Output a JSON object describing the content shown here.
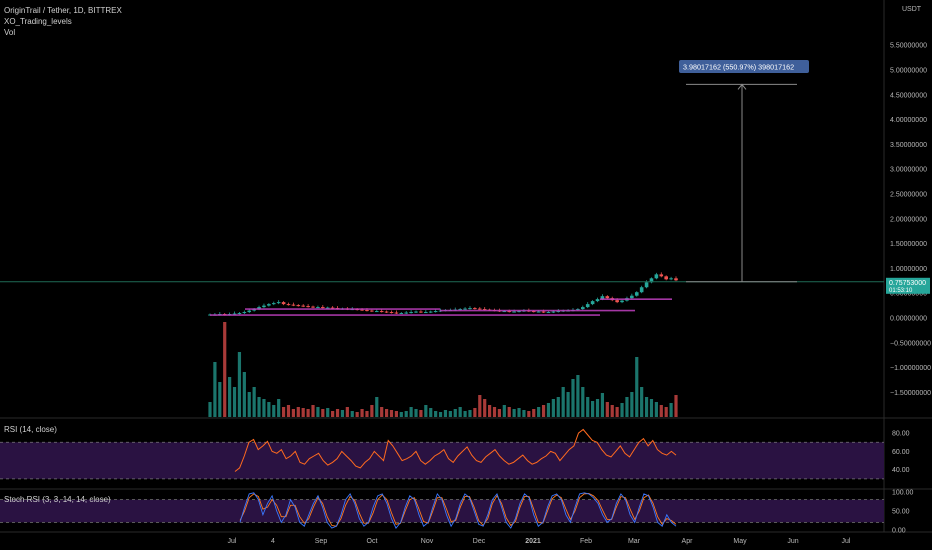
{
  "header": {
    "symbol_line": "OriginTrail / Tether, 1D, BITTREX",
    "indicator_1": "XO_Trading_levels",
    "indicator_2": "Vol"
  },
  "chart_data": {
    "type": "candlestick",
    "currency_label": "USDT",
    "price_axis_ticks": [
      "5.50000000",
      "5.00000000",
      "4.50000000",
      "4.00000000",
      "3.50000000",
      "3.00000000",
      "2.50000000",
      "2.00000000",
      "1.50000000",
      "1.00000000",
      "0.50000000",
      "0.00000000",
      "−0.50000000",
      "−1.00000000",
      "−1.50000000"
    ],
    "price_axis_values": [
      5.5,
      5.0,
      4.5,
      4.0,
      3.5,
      3.0,
      2.5,
      2.0,
      1.5,
      1.0,
      0.5,
      0.0,
      -0.5,
      -1.0,
      -1.5
    ],
    "x_tick_labels": [
      "Jul",
      "4",
      "Sep",
      "Oct",
      "Nov",
      "Dec",
      "2021",
      "Feb",
      "Mar",
      "Apr",
      "May",
      "Jun",
      "Jul"
    ],
    "current_price": "0.75753000",
    "countdown": "01:53:10",
    "measure_label": "3.98017162 (550.97%) 398017162",
    "measure_from": 0.73,
    "measure_to": 4.71,
    "price_path": [
      0.07,
      0.07,
      0.08,
      0.07,
      0.08,
      0.09,
      0.1,
      0.12,
      0.15,
      0.18,
      0.22,
      0.25,
      0.28,
      0.3,
      0.32,
      0.28,
      0.27,
      0.26,
      0.25,
      0.24,
      0.23,
      0.22,
      0.22,
      0.21,
      0.21,
      0.2,
      0.19,
      0.19,
      0.18,
      0.18,
      0.17,
      0.16,
      0.15,
      0.14,
      0.14,
      0.13,
      0.12,
      0.11,
      0.1,
      0.1,
      0.11,
      0.12,
      0.13,
      0.12,
      0.12,
      0.13,
      0.14,
      0.15,
      0.16,
      0.16,
      0.17,
      0.18,
      0.19,
      0.2,
      0.19,
      0.18,
      0.17,
      0.16,
      0.15,
      0.14,
      0.14,
      0.13,
      0.13,
      0.14,
      0.15,
      0.14,
      0.13,
      0.13,
      0.12,
      0.12,
      0.13,
      0.14,
      0.15,
      0.15,
      0.16,
      0.18,
      0.22,
      0.28,
      0.34,
      0.38,
      0.44,
      0.4,
      0.36,
      0.32,
      0.35,
      0.4,
      0.45,
      0.52,
      0.62,
      0.72,
      0.8,
      0.88,
      0.84,
      0.78,
      0.8,
      0.76
    ],
    "levels": [
      {
        "value": 0.06,
        "color": "#c040c0"
      },
      {
        "value": 0.2,
        "color": "#c040c0"
      },
      {
        "value": 0.15,
        "color": "#c040c0"
      },
      {
        "value": 0.35,
        "color": "#c040c0"
      }
    ],
    "volume": [
      0.15,
      0.55,
      0.35,
      0.95,
      0.4,
      0.3,
      0.65,
      0.45,
      0.25,
      0.3,
      0.2,
      0.18,
      0.15,
      0.12,
      0.18,
      0.1,
      0.12,
      0.08,
      0.1,
      0.09,
      0.08,
      0.12,
      0.1,
      0.08,
      0.09,
      0.06,
      0.08,
      0.07,
      0.1,
      0.06,
      0.05,
      0.08,
      0.06,
      0.12,
      0.2,
      0.1,
      0.08,
      0.07,
      0.06,
      0.05,
      0.06,
      0.1,
      0.08,
      0.07,
      0.12,
      0.09,
      0.06,
      0.05,
      0.07,
      0.06,
      0.08,
      0.1,
      0.06,
      0.07,
      0.09,
      0.22,
      0.18,
      0.12,
      0.1,
      0.08,
      0.12,
      0.1,
      0.08,
      0.09,
      0.07,
      0.06,
      0.08,
      0.1,
      0.12,
      0.14,
      0.18,
      0.2,
      0.3,
      0.25,
      0.38,
      0.42,
      0.3,
      0.2,
      0.16,
      0.18,
      0.24,
      0.15,
      0.12,
      0.1,
      0.14,
      0.2,
      0.25,
      0.6,
      0.3,
      0.2,
      0.18,
      0.15,
      0.12,
      0.1,
      0.14,
      0.22
    ],
    "rsi": {
      "label": "RSI (14, close)",
      "ticks": [
        "80.00",
        "60.00",
        "40.00"
      ],
      "tick_values": [
        80,
        60,
        40
      ],
      "band": [
        30,
        70
      ],
      "values": [
        38,
        42,
        55,
        70,
        73,
        62,
        66,
        71,
        60,
        58,
        62,
        52,
        55,
        60,
        48,
        46,
        52,
        55,
        58,
        50,
        45,
        48,
        52,
        60,
        55,
        50,
        44,
        42,
        48,
        52,
        60,
        55,
        50,
        72,
        66,
        58,
        50,
        52,
        55,
        60,
        50,
        46,
        50,
        55,
        58,
        62,
        52,
        48,
        55,
        60,
        65,
        56,
        50,
        48,
        54,
        58,
        62,
        55,
        50,
        46,
        48,
        52,
        56,
        50,
        46,
        48,
        52,
        55,
        60,
        58,
        50,
        56,
        62,
        66,
        80,
        84,
        78,
        72,
        70,
        62,
        56,
        54,
        60,
        66,
        58,
        54,
        62,
        70,
        74,
        66,
        72,
        62,
        58,
        56,
        60,
        56
      ]
    },
    "stoch_rsi": {
      "label": "Stoch RSI (3, 3, 14, 14, close)",
      "ticks": [
        "100.00",
        "50.00",
        "0.00"
      ],
      "tick_values": [
        100,
        50,
        0
      ],
      "band": [
        20,
        80
      ],
      "k": [
        20,
        60,
        95,
        98,
        80,
        40,
        70,
        90,
        50,
        20,
        40,
        80,
        60,
        20,
        10,
        40,
        70,
        90,
        60,
        20,
        5,
        10,
        40,
        80,
        95,
        70,
        30,
        10,
        20,
        60,
        90,
        95,
        70,
        30,
        5,
        20,
        60,
        90,
        80,
        40,
        10,
        20,
        60,
        95,
        80,
        40,
        10,
        30,
        70,
        95,
        85,
        50,
        15,
        10,
        40,
        80,
        95,
        60,
        20,
        5,
        30,
        70,
        95,
        85,
        40,
        10,
        20,
        60,
        90,
        95,
        80,
        40,
        20,
        60,
        95,
        98,
        95,
        85,
        70,
        40,
        20,
        30,
        70,
        95,
        80,
        40,
        20,
        60,
        95,
        90,
        60,
        20,
        10,
        40,
        20,
        10
      ],
      "d": [
        25,
        50,
        85,
        95,
        88,
        55,
        60,
        80,
        65,
        35,
        35,
        65,
        65,
        35,
        18,
        30,
        60,
        85,
        70,
        35,
        12,
        10,
        30,
        65,
        88,
        78,
        45,
        18,
        18,
        45,
        80,
        92,
        80,
        45,
        15,
        18,
        50,
        80,
        85,
        55,
        22,
        18,
        50,
        85,
        85,
        55,
        22,
        25,
        60,
        88,
        88,
        60,
        25,
        12,
        30,
        70,
        90,
        70,
        32,
        12,
        22,
        60,
        88,
        88,
        55,
        20,
        18,
        50,
        82,
        92,
        85,
        55,
        28,
        50,
        85,
        95,
        96,
        90,
        78,
        52,
        28,
        28,
        60,
        88,
        85,
        55,
        28,
        50,
        85,
        92,
        70,
        35,
        15,
        30,
        25,
        15
      ]
    }
  },
  "colors": {
    "up": "#26a69a",
    "down": "#ef5350",
    "rsi_line": "#ff6a1f",
    "stoch_k": "#3a78ff",
    "stoch_d": "#ff7a1f",
    "band_fill": "#2a1242",
    "price_badge": "#26a69a",
    "measure_badge": "#3f5f9a",
    "hline": "#1f6a55"
  }
}
